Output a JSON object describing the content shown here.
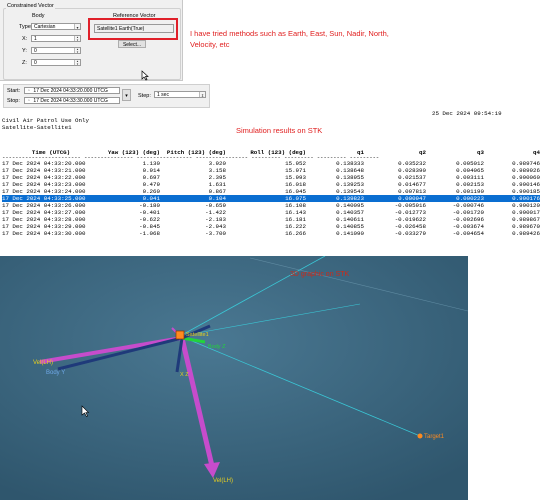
{
  "constrained_vector": {
    "title": "Constrained Vector",
    "body_label": "Body",
    "ref_label": "Reference Vector",
    "type_label": "Type:",
    "type_value": "Cartesian",
    "x_label": "X:",
    "x_value": "1",
    "y_label": "Y:",
    "y_value": "0",
    "z_label": "Z:",
    "z_value": "0",
    "ref_value": "Satellite1 Earth(True)",
    "select_button": "Select..."
  },
  "annotation_methods": "I have tried methods such as Earth, East, Sun, Nadir, North, Velocity, etc",
  "time": {
    "start_label": "Start:",
    "start_value": "17 Dec 2024 04:33:20.000 UTCG",
    "stop_label": "Stop:",
    "stop_value": "17 Dec 2024 04:33:30.000 UTCG",
    "step_label": "Step:",
    "step_value": "1 sec"
  },
  "report": {
    "timestamp": "25 Dec 2024 09:54:19",
    "org": "Civil Air Patrol Use Only",
    "object": "Satellite-Satellite1",
    "annotation": "Simulation results on STK",
    "columns": [
      "Time (UTCG)",
      "Yaw (123) (deg)",
      "Pitch (123) (deg)",
      "Roll (123) (deg)",
      "q1",
      "q2",
      "q3",
      "q4"
    ],
    "rows": [
      [
        "17 Dec 2024 04:33:20.000",
        "1.130",
        "3.920",
        "15.952",
        "0.138333",
        "0.035232",
        "0.005012",
        "0.989746"
      ],
      [
        "17 Dec 2024 04:33:21.000",
        "0.914",
        "3.158",
        "15.971",
        "0.138648",
        "0.028390",
        "0.004065",
        "0.989926"
      ],
      [
        "17 Dec 2024 04:33:22.000",
        "0.697",
        "2.395",
        "15.993",
        "0.138955",
        "0.021537",
        "0.003111",
        "0.990060"
      ],
      [
        "17 Dec 2024 04:33:23.000",
        "0.479",
        "1.631",
        "16.018",
        "0.139253",
        "0.014677",
        "0.002153",
        "0.990146"
      ],
      [
        "17 Dec 2024 04:33:24.000",
        "0.260",
        "0.867",
        "16.045",
        "0.139543",
        "0.007813",
        "0.001190",
        "0.990185"
      ],
      [
        "17 Dec 2024 04:33:25.000",
        "0.041",
        "0.104",
        "16.075",
        "0.139823",
        "0.000947",
        "0.000223",
        "0.990176"
      ],
      [
        "17 Dec 2024 04:33:26.000",
        "-0.180",
        "-0.659",
        "16.108",
        "0.140095",
        "-0.005916",
        "-0.000746",
        "0.990120"
      ],
      [
        "17 Dec 2024 04:33:27.000",
        "-0.401",
        "-1.422",
        "16.143",
        "0.140357",
        "-0.012773",
        "-0.001720",
        "0.990017"
      ],
      [
        "17 Dec 2024 04:33:28.000",
        "-0.622",
        "-2.183",
        "16.181",
        "0.140611",
        "-0.019622",
        "-0.002696",
        "0.989867"
      ],
      [
        "17 Dec 2024 04:33:29.000",
        "-0.845",
        "-2.943",
        "16.222",
        "0.140855",
        "-0.026458",
        "-0.003674",
        "0.989670"
      ],
      [
        "17 Dec 2024 04:33:30.000",
        "-1.068",
        "-3.700",
        "16.266",
        "0.141090",
        "-0.033279",
        "-0.004654",
        "0.989426"
      ]
    ],
    "selected_row": 5
  },
  "view3d": {
    "annotation": "3D graphic on STK",
    "labels": {
      "vel_x": "Vel(LH)",
      "body_y": "Body Y",
      "body_z": "Body Z",
      "body_x_short": "X Z",
      "sat": "Satellite1",
      "target": "Target1",
      "vel_down": "Vel(LH)"
    },
    "colors": {
      "background": "#3e6780",
      "magenta": "#c64ccc",
      "navy": "#1f3a7a",
      "green": "#22d23c",
      "cyan": "#3ac7d6",
      "orange": "#ff8a1f",
      "red_text": "#cc2a1a"
    }
  }
}
